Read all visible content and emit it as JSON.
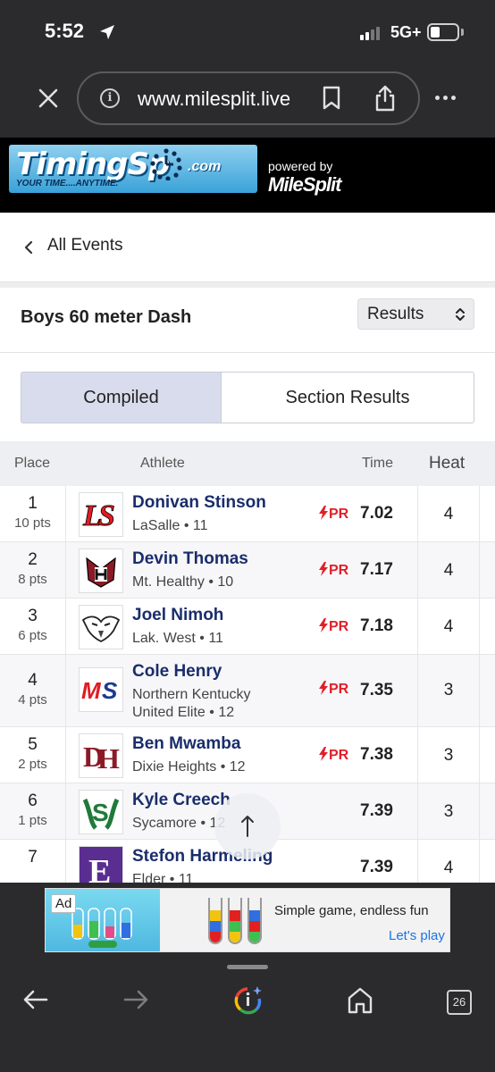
{
  "status_bar": {
    "time": "5:52",
    "network": "5G+",
    "signal_bars": 4,
    "signal_active": 2,
    "battery_level": 0.35
  },
  "browser": {
    "url": "www.milesplit.live"
  },
  "banner": {
    "logo_text": "TimingSp",
    "logo_suffix": ".com",
    "logo_tagline": "YOUR TIME....ANYTIME.",
    "powered_by": "powered by",
    "partner": "MileSplit"
  },
  "nav": {
    "back_label": "All Events"
  },
  "event": {
    "title": "Boys 60 meter Dash",
    "view_select": "Results"
  },
  "tabs": [
    {
      "label": "Compiled",
      "active": true
    },
    {
      "label": "Section Results",
      "active": false
    }
  ],
  "table": {
    "headers": {
      "place": "Place",
      "athlete": "Athlete",
      "time": "Time",
      "heat": "Heat"
    },
    "rows": [
      {
        "place": "1",
        "pts": "10 pts",
        "name": "Donivan Stinson",
        "team": "LaSalle • 11",
        "pr": "PR",
        "time": "7.02",
        "heat": "4",
        "logo": "LS"
      },
      {
        "place": "2",
        "pts": "8 pts",
        "name": "Devin Thomas",
        "team": "Mt. Healthy • 10",
        "pr": "PR",
        "time": "7.17",
        "heat": "4",
        "logo": "MH"
      },
      {
        "place": "3",
        "pts": "6 pts",
        "name": "Joel Nimoh",
        "team": "Lak. West • 11",
        "pr": "PR",
        "time": "7.18",
        "heat": "4",
        "logo": "eagle"
      },
      {
        "place": "4",
        "pts": "4 pts",
        "name": "Cole Henry",
        "team_line1": "Northern Kentucky",
        "team_line2": "United Elite • 12",
        "pr": "PR",
        "time": "7.35",
        "heat": "3",
        "logo": "MS"
      },
      {
        "place": "5",
        "pts": "2 pts",
        "name": "Ben Mwamba",
        "team": "Dixie Heights • 12",
        "pr": "PR",
        "time": "7.38",
        "heat": "3",
        "logo": "DH"
      },
      {
        "place": "6",
        "pts": "1 pts",
        "name": "Kyle Creech",
        "team": "Sycamore • 12",
        "pr": "",
        "time": "7.39",
        "heat": "3",
        "logo": "S"
      },
      {
        "place": "7",
        "pts": "",
        "name": "Stefon Harmeling",
        "team": "Elder • 11",
        "pr": "",
        "time": "7.39",
        "heat": "4",
        "logo": "E"
      }
    ]
  },
  "ad": {
    "badge": "Ad",
    "text": "Simple game, endless fun",
    "cta": "Let's play"
  },
  "bottom_nav": {
    "tab_count": "26"
  }
}
